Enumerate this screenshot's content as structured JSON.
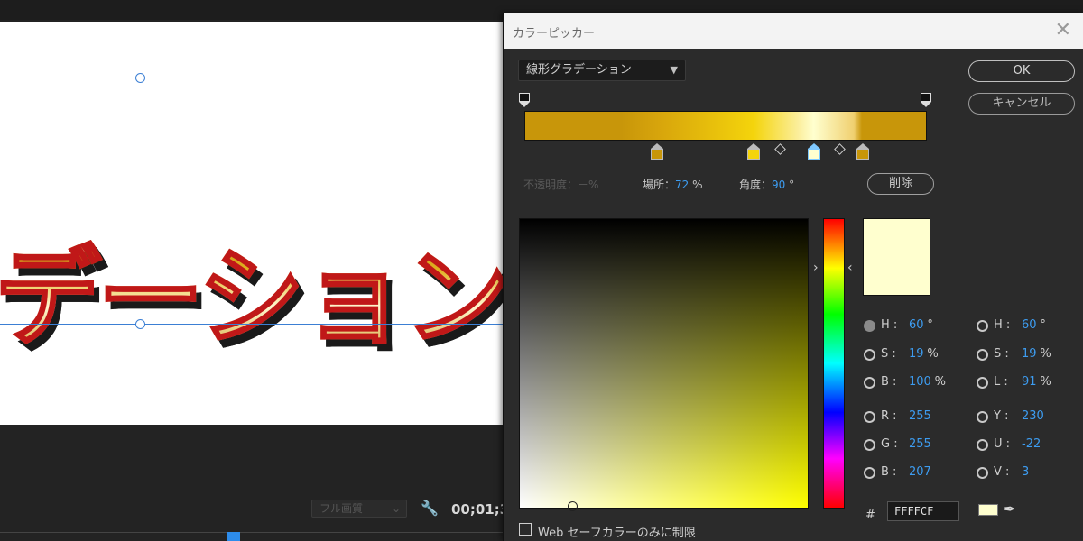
{
  "editor": {
    "canvas_text": "デーション",
    "quality": "フル画質",
    "timecode": "00;01;3"
  },
  "dialog": {
    "title": "カラーピッカー",
    "gradient_type": "線形グラデーション",
    "ok_label": "OK",
    "cancel_label": "キャンセル",
    "delete_label": "削除",
    "opacity_label": "不透明度：－%",
    "location_label": "場所：",
    "location_value": "72",
    "location_unit": "%",
    "angle_label": "角度：",
    "angle_value": "90",
    "angle_unit": "°",
    "selected_color": "#FFFFCF",
    "gradient_stops": [
      {
        "color": "#c8960a",
        "position": 0.33
      },
      {
        "color": "#f4d40c",
        "position": 0.57
      },
      {
        "color": "#ffffcf",
        "position": 0.72,
        "selected": true
      },
      {
        "color": "#c8960a",
        "position": 0.84
      }
    ],
    "fields_left": [
      {
        "label": "H",
        "value": "60",
        "unit": "°",
        "checked": true
      },
      {
        "label": "S",
        "value": "19",
        "unit": "%"
      },
      {
        "label": "B",
        "value": "100",
        "unit": "%"
      },
      {
        "label": "R",
        "value": "255",
        "unit": ""
      },
      {
        "label": "G",
        "value": "255",
        "unit": ""
      },
      {
        "label": "B",
        "value": "207",
        "unit": ""
      }
    ],
    "fields_right": [
      {
        "label": "H",
        "value": "60",
        "unit": "°"
      },
      {
        "label": "S",
        "value": "19",
        "unit": "%"
      },
      {
        "label": "L",
        "value": "91",
        "unit": "%"
      },
      {
        "label": "Y",
        "value": "230",
        "unit": ""
      },
      {
        "label": "U",
        "value": "-22",
        "unit": ""
      },
      {
        "label": "V",
        "value": "3",
        "unit": ""
      }
    ],
    "hash": "#",
    "hex_value": "FFFFCF",
    "web_safe_label": "Web セーフカラーのみに制限"
  }
}
